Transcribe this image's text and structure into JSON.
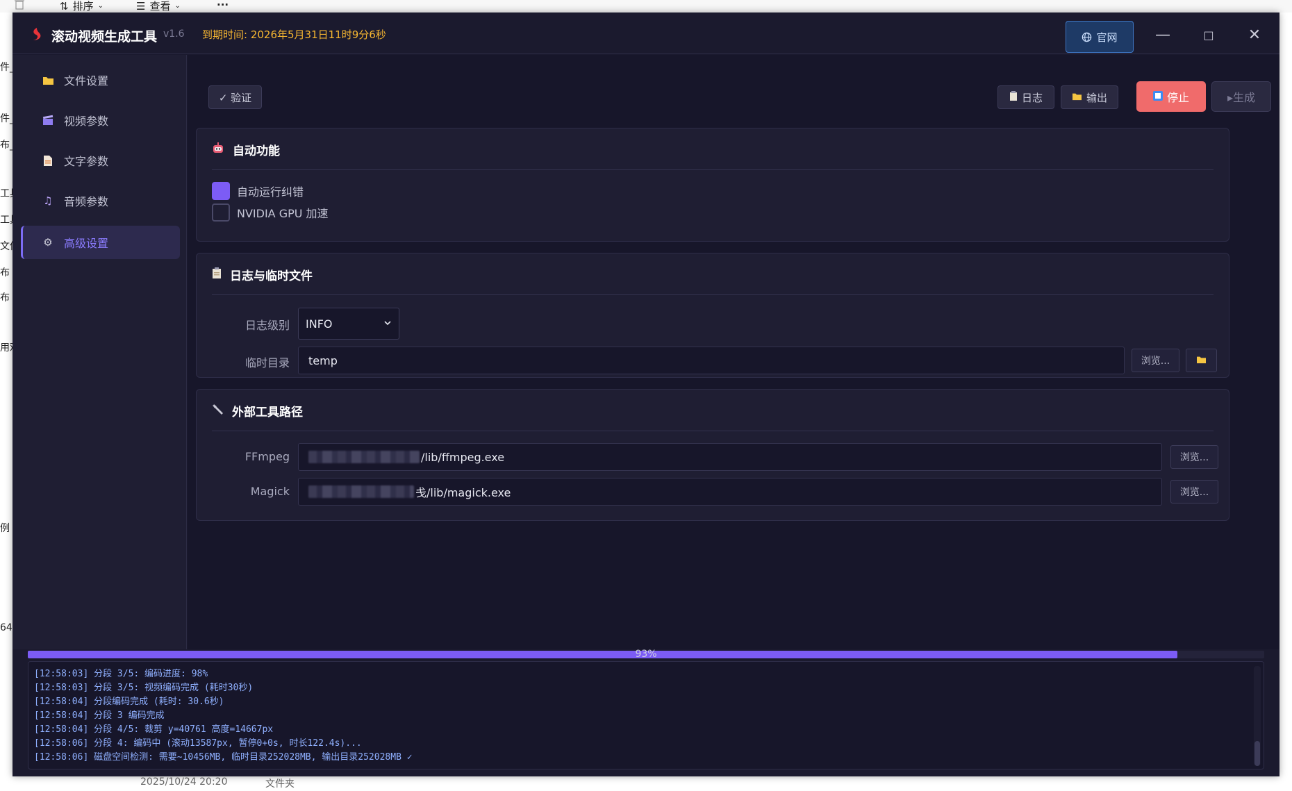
{
  "explorer": {
    "sort_label": "排序",
    "view_label": "查看",
    "more_label": "···",
    "left_fragments": [
      "件_",
      "件_",
      "布_",
      "工具",
      "工具",
      "文件",
      "布",
      "布",
      "用观",
      "例",
      "64"
    ],
    "bottom_date": "2025/10/24 20:20",
    "bottom_type": "文件夹"
  },
  "app": {
    "title": "滚动视频生成工具",
    "version": "v1.6",
    "expire": "到期时间: 2026年5月31日11时9分6秒",
    "site_button": "官网",
    "minimize": "—",
    "maximize": "□",
    "close": "✕",
    "accent": "#7c5cf5",
    "stop_color": "#f06b6b"
  },
  "sidebar": {
    "items": [
      {
        "label": "文件设置",
        "icon": "folder-icon"
      },
      {
        "label": "视频参数",
        "icon": "clapper-icon"
      },
      {
        "label": "文字参数",
        "icon": "document-icon"
      },
      {
        "label": "音频参数",
        "icon": "music-icon"
      },
      {
        "label": "高级设置",
        "icon": "gear-icon"
      }
    ],
    "active_index": 4
  },
  "toolbar": {
    "verify": "✓ 验证",
    "log": "日志",
    "output": "输出",
    "stop": "停止",
    "generate": "▸生成"
  },
  "auto": {
    "title": "自动功能",
    "options": [
      {
        "label": "自动运行纠错",
        "checked": true
      },
      {
        "label": "NVIDIA GPU 加速",
        "checked": false
      }
    ]
  },
  "logs_temp": {
    "title": "日志与临时文件",
    "log_level_label": "日志级别",
    "log_level_value": "INFO",
    "temp_dir_label": "临时目录",
    "temp_dir_value": "temp",
    "browse": "浏览..."
  },
  "tools": {
    "title": "外部工具路径",
    "ffmpeg_label": "FFmpeg",
    "ffmpeg_value": "/lib/ffmpeg.exe",
    "magick_label": "Magick",
    "magick_value": "戋/lib/magick.exe",
    "browse": "浏览..."
  },
  "progress": {
    "percent": 93,
    "text": "93%"
  },
  "log_lines": [
    "[12:58:03] 分段 3/5: 编码进度: 98%",
    "[12:58:03] 分段 3/5: 视频编码完成 (耗时30秒)",
    "[12:58:04] 分段编码完成 (耗时: 30.6秒)",
    "[12:58:04] 分段 3 编码完成",
    "[12:58:04] 分段 4/5: 裁剪 y=40761 高度=14667px",
    "[12:58:06] 分段 4: 编码中 (滚动13587px, 暂停0+0s, 时长122.4s)...",
    "[12:58:06] 磁盘空间检测: 需要~10456MB, 临时目录252028MB, 输出目录252028MB ✓"
  ]
}
